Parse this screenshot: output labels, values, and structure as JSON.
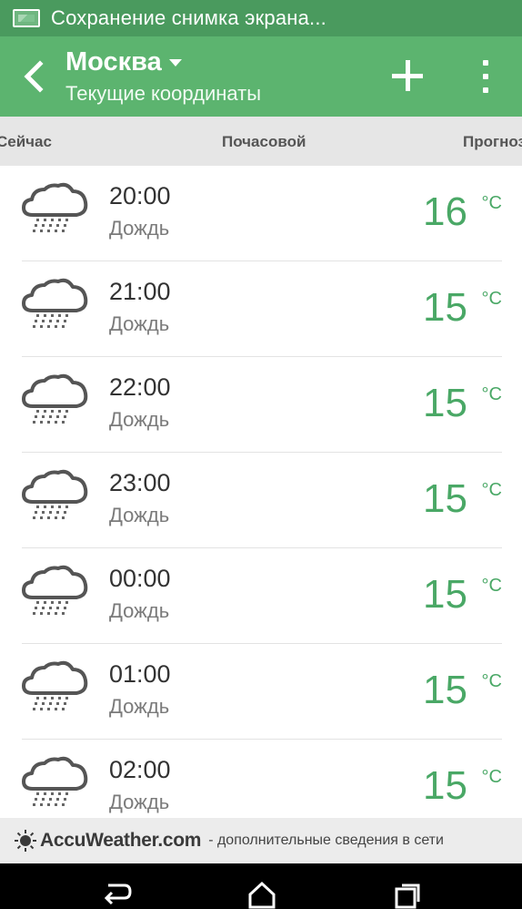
{
  "status_bar": {
    "notification_text": "Сохранение снимка экрана..."
  },
  "app_bar": {
    "city": "Москва",
    "subtitle": "Текущие координаты"
  },
  "tabs": [
    {
      "label": "Сейчас"
    },
    {
      "label": "Почасовой"
    },
    {
      "label": "Прогноз"
    }
  ],
  "forecast": [
    {
      "time": "20:00",
      "condition": "Дождь",
      "temp": "16",
      "unit": "°C",
      "icon": "rain-cloud-icon"
    },
    {
      "time": "21:00",
      "condition": "Дождь",
      "temp": "15",
      "unit": "°C",
      "icon": "rain-cloud-icon"
    },
    {
      "time": "22:00",
      "condition": "Дождь",
      "temp": "15",
      "unit": "°C",
      "icon": "rain-cloud-icon"
    },
    {
      "time": "23:00",
      "condition": "Дождь",
      "temp": "15",
      "unit": "°C",
      "icon": "rain-cloud-icon"
    },
    {
      "time": "00:00",
      "condition": "Дождь",
      "temp": "15",
      "unit": "°C",
      "icon": "rain-cloud-icon"
    },
    {
      "time": "01:00",
      "condition": "Дождь",
      "temp": "15",
      "unit": "°C",
      "icon": "rain-cloud-icon"
    },
    {
      "time": "02:00",
      "condition": "Дождь",
      "temp": "15",
      "unit": "°C",
      "icon": "rain-cloud-icon"
    }
  ],
  "footer": {
    "brand": "AccuWeather.com",
    "more_text": "- дополнительные сведения в сети"
  },
  "colors": {
    "status_bar": "#4a9a5e",
    "app_bar": "#5cb46f",
    "accent_temp": "#4aa866"
  }
}
